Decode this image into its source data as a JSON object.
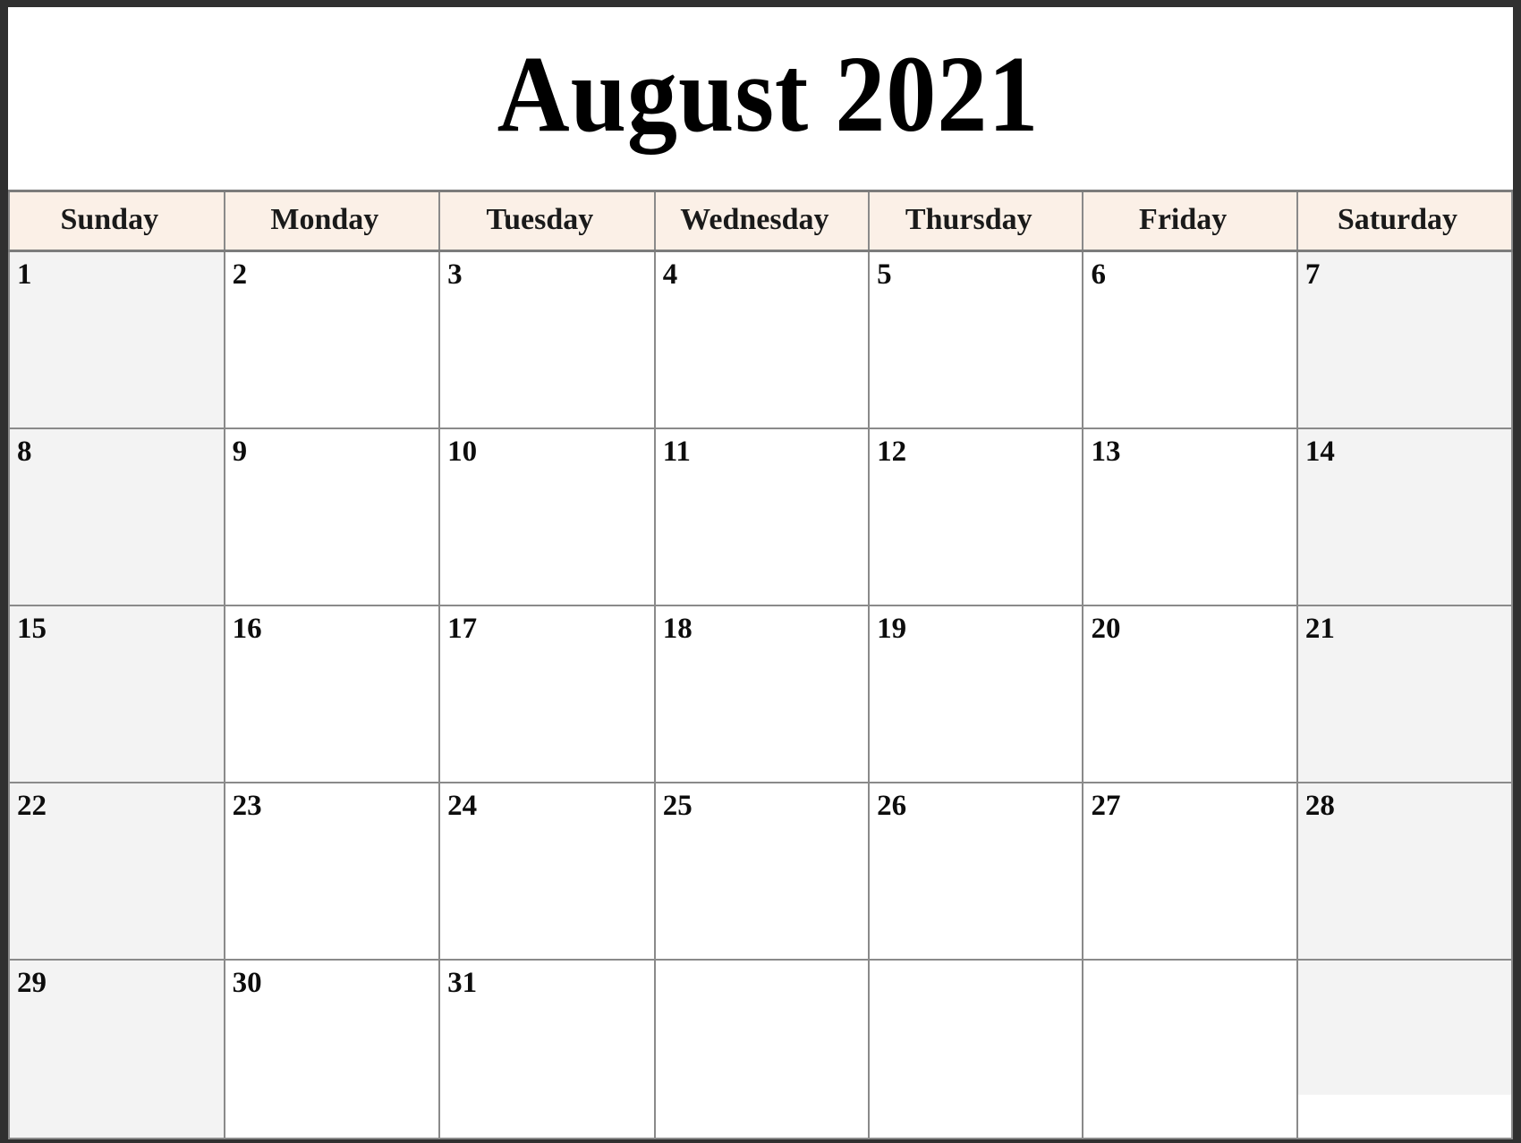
{
  "calendar": {
    "title": "August 2021",
    "month": "August",
    "year": "2021",
    "colors": {
      "header_background": "#fbf0e7",
      "weekend_background": "#f3f3f3",
      "weekday_background": "#ffffff",
      "frame_border": "#303030",
      "cell_border": "#8a8a8a",
      "text": "#0d0d0d"
    },
    "weekdays": [
      {
        "label": "Sunday",
        "short": "Sun",
        "weekend": true
      },
      {
        "label": "Monday",
        "short": "Mon",
        "weekend": false
      },
      {
        "label": "Tuesday",
        "short": "Tue",
        "weekend": false
      },
      {
        "label": "Wednesday",
        "short": "Wed",
        "weekend": false
      },
      {
        "label": "Thursday",
        "short": "Thu",
        "weekend": false
      },
      {
        "label": "Friday",
        "short": "Fri",
        "weekend": false
      },
      {
        "label": "Saturday",
        "short": "Sat",
        "weekend": true
      }
    ],
    "weeks": [
      {
        "days": [
          {
            "date": "1"
          },
          {
            "date": "2"
          },
          {
            "date": "3"
          },
          {
            "date": "4"
          },
          {
            "date": "5"
          },
          {
            "date": "6"
          },
          {
            "date": "7"
          }
        ]
      },
      {
        "days": [
          {
            "date": "8"
          },
          {
            "date": "9"
          },
          {
            "date": "10"
          },
          {
            "date": "11"
          },
          {
            "date": "12"
          },
          {
            "date": "13"
          },
          {
            "date": "14"
          }
        ]
      },
      {
        "days": [
          {
            "date": "15"
          },
          {
            "date": "16"
          },
          {
            "date": "17"
          },
          {
            "date": "18"
          },
          {
            "date": "19"
          },
          {
            "date": "20"
          },
          {
            "date": "21"
          }
        ]
      },
      {
        "days": [
          {
            "date": "22"
          },
          {
            "date": "23"
          },
          {
            "date": "24"
          },
          {
            "date": "25"
          },
          {
            "date": "26"
          },
          {
            "date": "27"
          },
          {
            "date": "28"
          }
        ]
      },
      {
        "days": [
          {
            "date": "29"
          },
          {
            "date": "30"
          },
          {
            "date": "31"
          },
          {
            "date": ""
          },
          {
            "date": ""
          },
          {
            "date": ""
          },
          {
            "date": ""
          }
        ]
      }
    ]
  }
}
